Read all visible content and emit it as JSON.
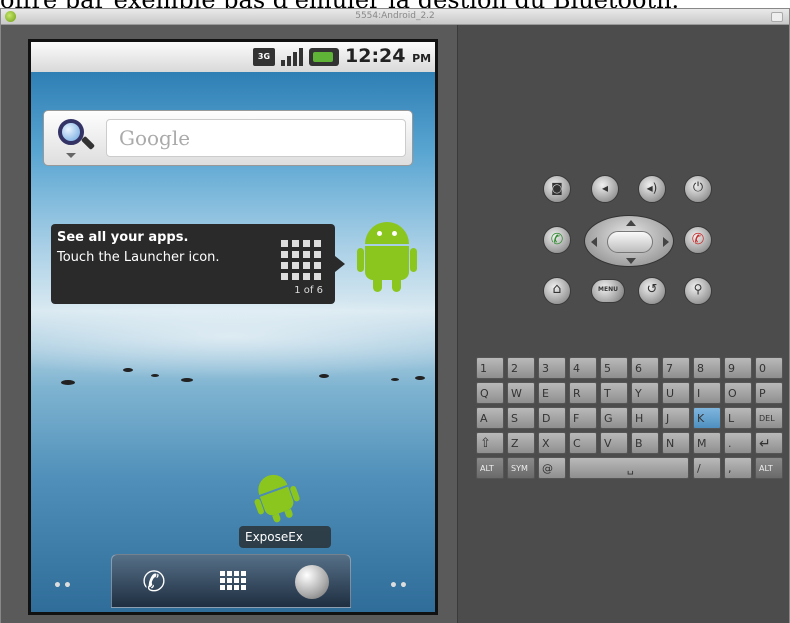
{
  "caption": "offre par exemple pas d'émuler la gestion du Bluetooth.",
  "window": {
    "title": "5554:Android_2.2"
  },
  "status_bar": {
    "network": "3G",
    "time": "12:24",
    "ampm": "PM"
  },
  "search_widget": {
    "placeholder": "Google"
  },
  "tooltip": {
    "title": "See all your apps.",
    "body": "Touch the Launcher icon.",
    "page": "1 of 6"
  },
  "app_icon": {
    "label": "ExposeEx"
  },
  "dock": {
    "items": [
      "phone-icon",
      "launcher-icon",
      "browser-icon"
    ]
  },
  "side_dots": "••",
  "hardware_controls": {
    "top_row": [
      "camera-icon",
      "volume-down-icon",
      "volume-up-icon",
      "power-icon"
    ],
    "call_label": "✆",
    "hangup_label": "✆",
    "bottom_row": [
      "home-icon",
      "menu-icon",
      "back-icon",
      "search-icon"
    ],
    "menu_text": "MENU"
  },
  "keyboard": {
    "row1": [
      "1",
      "2",
      "3",
      "4",
      "5",
      "6",
      "7",
      "8",
      "9",
      "0"
    ],
    "row2": [
      "Q",
      "W",
      "E",
      "R",
      "T",
      "Y",
      "U",
      "I",
      "O",
      "P"
    ],
    "row3": [
      "A",
      "S",
      "D",
      "F",
      "G",
      "H",
      "J",
      "K",
      "L",
      "DEL"
    ],
    "row4": [
      "⇧",
      "Z",
      "X",
      "C",
      "V",
      "B",
      "N",
      "M",
      ".",
      "↵"
    ],
    "row5": [
      "ALT",
      "SYM",
      "@",
      "␣",
      "/",
      ",",
      "ALT"
    ],
    "highlighted_key": "K",
    "colors": {
      "highlight": "#5b9bd0"
    }
  }
}
